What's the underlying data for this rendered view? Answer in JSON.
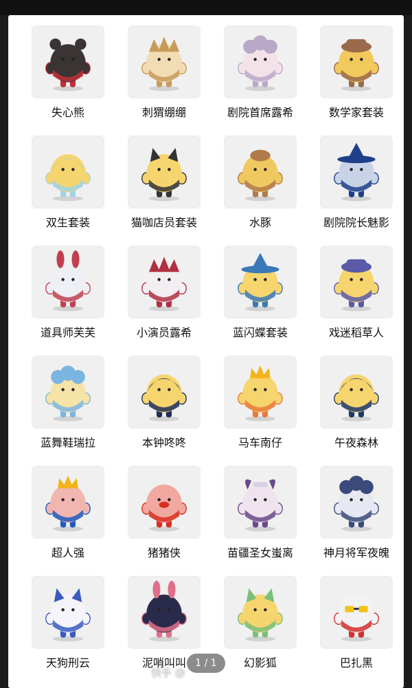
{
  "items": [
    {
      "name": "失心熊",
      "body": "#3a3434",
      "accent": "#c0303a",
      "hat": "ears"
    },
    {
      "name": "刺猬绷绷",
      "body": "#f1dcb4",
      "accent": "#c89a5a",
      "hat": "spikes"
    },
    {
      "name": "剧院首席露希",
      "body": "#f3e3e8",
      "accent": "#b9a9c8",
      "hat": "curls"
    },
    {
      "name": "数学家套装",
      "body": "#f2c95c",
      "accent": "#9a6b4a",
      "hat": "cap"
    },
    {
      "name": "双生套装",
      "body": "#f6d56e",
      "accent": "#9fd3e6",
      "hat": "hood"
    },
    {
      "name": "猫咖店员套装",
      "body": "#f6d56e",
      "accent": "#333333",
      "hat": "cat"
    },
    {
      "name": "水豚",
      "body": "#f0c860",
      "accent": "#b07a4a",
      "hat": "capybara"
    },
    {
      "name": "剧院院长魅影",
      "body": "#c9d3e8",
      "accent": "#1f3f8a",
      "hat": "wizard"
    },
    {
      "name": "道具师芙芙",
      "body": "#eef0f6",
      "accent": "#c04050",
      "hat": "bunny"
    },
    {
      "name": "小演员露希",
      "body": "#f2eef2",
      "accent": "#b03040",
      "hat": "spikes"
    },
    {
      "name": "蓝闪蝶套装",
      "body": "#f6d56e",
      "accent": "#3a78b8",
      "hat": "wizard"
    },
    {
      "name": "戏迷稻草人",
      "body": "#f6d56e",
      "accent": "#5a5aa8",
      "hat": "cap"
    },
    {
      "name": "蓝舞鞋瑞拉",
      "body": "#f6e3a8",
      "accent": "#7ab6e0",
      "hat": "curls"
    },
    {
      "name": "本钟咚咚",
      "body": "#f6d56e",
      "accent": "#1f2f5a",
      "hat": "hood"
    },
    {
      "name": "马车南仔",
      "body": "#f6d56e",
      "accent": "#e87a3a",
      "hat": "crown"
    },
    {
      "name": "午夜森林",
      "body": "#f6d56e",
      "accent": "#1f3a6a",
      "hat": "hood"
    },
    {
      "name": "超人强",
      "body": "#f2b6b0",
      "accent": "#1f5ac0",
      "hat": "crown"
    },
    {
      "name": "猪猪侠",
      "body": "#f0a8a0",
      "accent": "#d83020",
      "hat": "pig"
    },
    {
      "name": "苗疆圣女蚩离",
      "body": "#efe4ee",
      "accent": "#6a4a8a",
      "hat": "horns"
    },
    {
      "name": "神月将军夜魄",
      "body": "#e6e8f2",
      "accent": "#3a4a7a",
      "hat": "curls"
    },
    {
      "name": "天狗刑云",
      "body": "#f4f4fa",
      "accent": "#3a5ac0",
      "hat": "cat"
    },
    {
      "name": "泥哨叫叫",
      "body": "#2a2a4a",
      "accent": "#e0708a",
      "hat": "bunny"
    },
    {
      "name": "幻影狐",
      "body": "#f6d56e",
      "accent": "#7ac07a",
      "hat": "cat"
    },
    {
      "name": "巴扎黑",
      "body": "#f2f2f2",
      "accent": "#d03030",
      "hat": "glasses"
    }
  ],
  "pager": {
    "text": "1 / 1"
  },
  "watermark": {
    "text": "快手 @"
  },
  "colors": {
    "background": "#1c1c1c",
    "card": "#ffffff",
    "thumb": "#f0f0f0"
  }
}
